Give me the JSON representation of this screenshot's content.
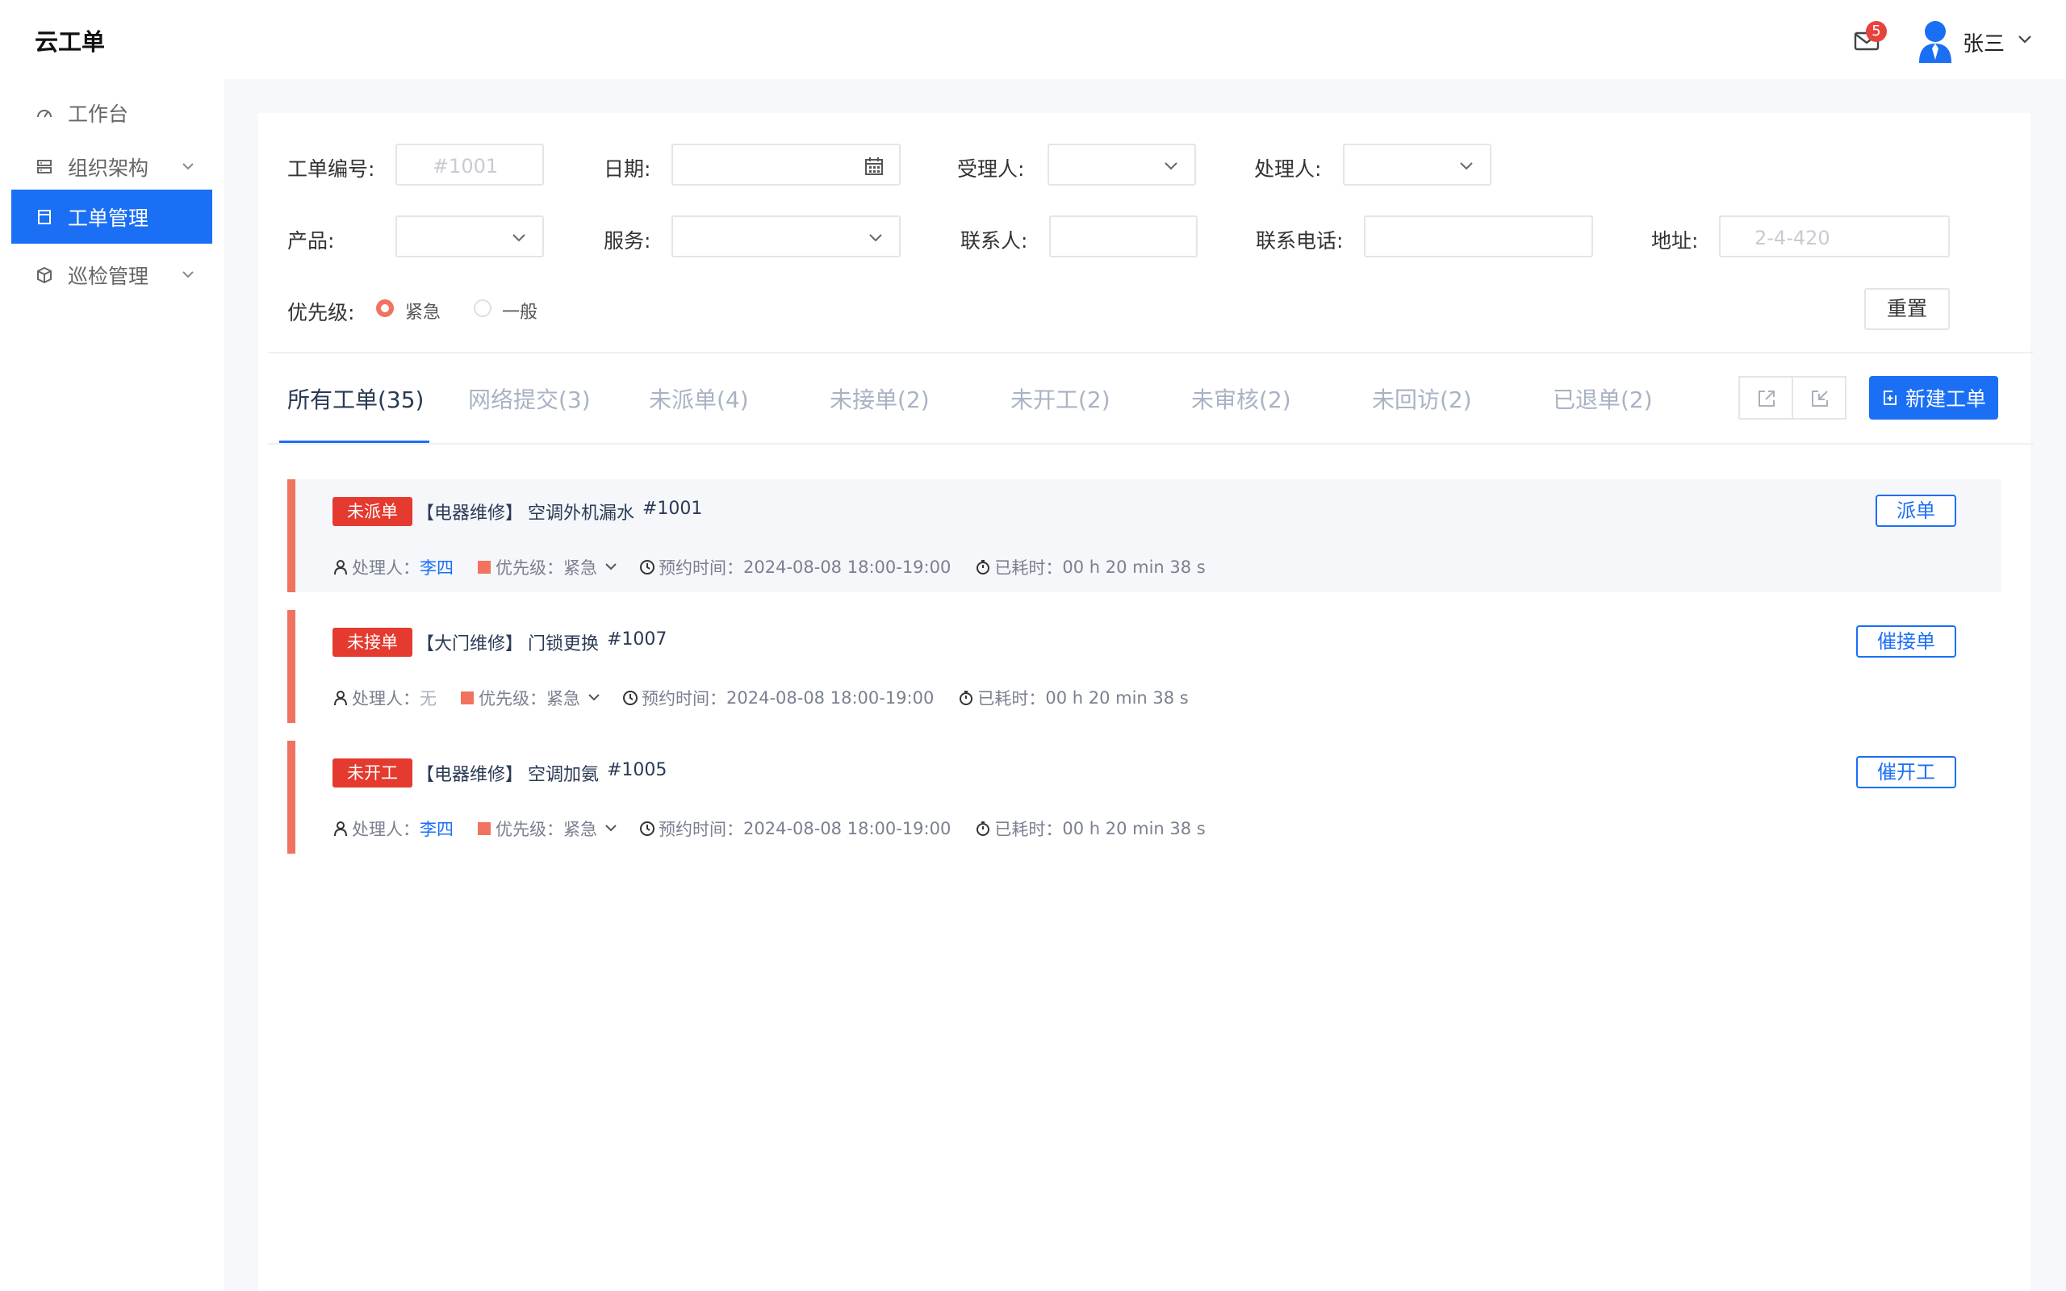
{
  "app": {
    "title": "云工单"
  },
  "header": {
    "mail_badge": "5",
    "username": "张三"
  },
  "sidebar": {
    "items": [
      {
        "label": "工作台",
        "icon": "dashboard-icon"
      },
      {
        "label": "组织架构",
        "icon": "org-icon",
        "expandable": true
      },
      {
        "label": "工单管理",
        "icon": "ticket-icon",
        "active": true
      },
      {
        "label": "巡检管理",
        "icon": "cube-icon",
        "expandable": true
      }
    ]
  },
  "filters": {
    "order_no_label": "工单编号:",
    "order_no_placeholder": "#1001",
    "date_label": "日期:",
    "assignee_label": "受理人:",
    "handler_label": "处理人:",
    "product_label": "产品:",
    "service_label": "服务:",
    "contact_label": "联系人:",
    "phone_label": "联系电话:",
    "address_label": "地址:",
    "address_placeholder": "2-4-420",
    "priority_label": "优先级:",
    "priority_options": [
      "紧急",
      "一般"
    ],
    "priority_selected": "紧急",
    "reset_label": "重置"
  },
  "tabs": [
    {
      "label": "所有工单(35)",
      "active": true
    },
    {
      "label": "网络提交(3)"
    },
    {
      "label": "未派单(4)"
    },
    {
      "label": "未接单(2)"
    },
    {
      "label": "未开工(2)"
    },
    {
      "label": "未审核(2)"
    },
    {
      "label": "未回访(2)"
    },
    {
      "label": "已退单(2)"
    }
  ],
  "toolbar": {
    "export_icon": "export-icon",
    "import_icon": "import-icon",
    "new_label": "新建工单"
  },
  "orders": [
    {
      "status": "未派单",
      "category": "【电器维修】",
      "title": "空调外机漏水",
      "no": "#1001",
      "handler_label": "处理人：",
      "handler": "李四",
      "priority_label": "优先级：",
      "priority": "紧急",
      "time_label": "预约时间：",
      "time": "2024-08-08 18:00-19:00",
      "elapsed_label": "已耗时：",
      "elapsed": "00 h 20 min 38 s",
      "action": "派单"
    },
    {
      "status": "未接单",
      "category": "【大门维修】",
      "title": "门锁更换",
      "no": "#1007",
      "handler_label": "处理人：",
      "handler": "无",
      "priority_label": "优先级：",
      "priority": "紧急",
      "time_label": "预约时间：",
      "time": "2024-08-08 18:00-19:00",
      "elapsed_label": "已耗时：",
      "elapsed": "00 h 20 min 38 s",
      "action": "催接单"
    },
    {
      "status": "未开工",
      "category": "【电器维修】",
      "title": "空调加氨",
      "no": "#1005",
      "handler_label": "处理人：",
      "handler": "李四",
      "priority_label": "优先级：",
      "priority": "紧急",
      "time_label": "预约时间：",
      "time": "2024-08-08 18:00-19:00",
      "elapsed_label": "已耗时：",
      "elapsed": "00 h 20 min 38 s",
      "action": "催开工"
    }
  ],
  "colors": {
    "primary": "#1a6ff5",
    "danger": "#e53a2f",
    "accent": "#f1735f"
  }
}
